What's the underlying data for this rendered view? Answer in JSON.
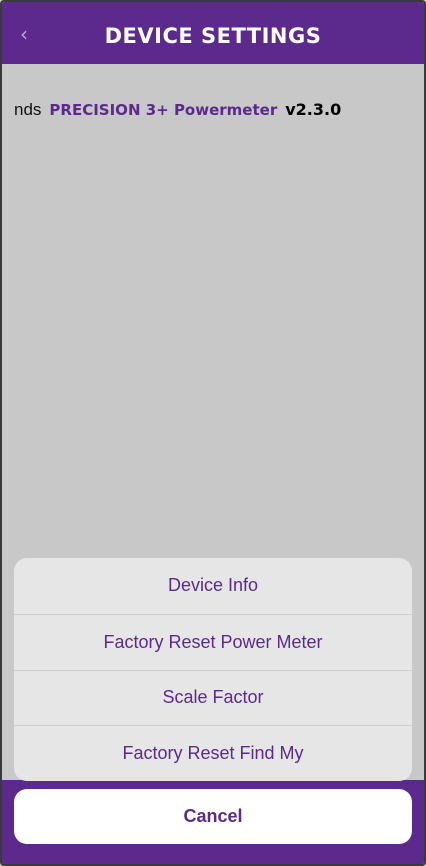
{
  "header": {
    "title": "DEVICE SETTINGS",
    "back_icon": "chevron-left-icon"
  },
  "device": {
    "prefix": "nds",
    "name": "PRECISION 3+ Powermeter",
    "version": "v2.3.0"
  },
  "action_sheet": {
    "items": [
      {
        "label": "Device Info"
      },
      {
        "label": "Factory Reset Power Meter"
      },
      {
        "label": "Scale Factor"
      },
      {
        "label": "Factory Reset Find My"
      }
    ],
    "cancel_label": "Cancel"
  },
  "colors": {
    "brand_purple": "#5b2a8c",
    "background": "#c8c8c8",
    "sheet": "#e6e6e6"
  }
}
